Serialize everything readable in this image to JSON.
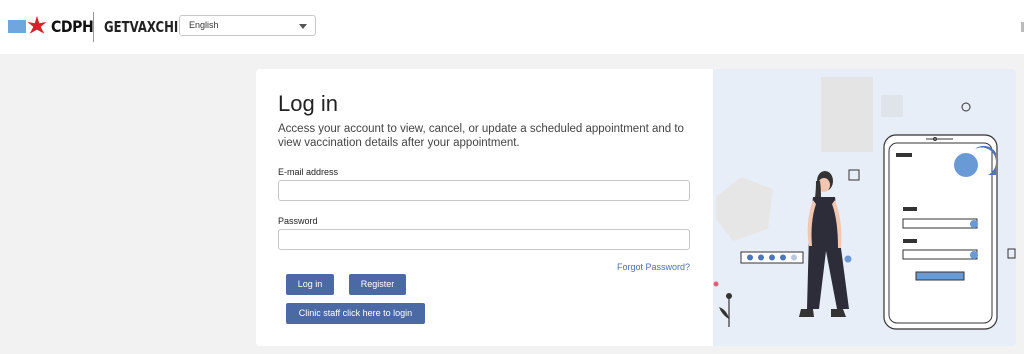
{
  "header": {
    "brand": "CDPH",
    "site_name": "GETVAXCHI",
    "language_value": "English"
  },
  "login": {
    "title": "Log in",
    "subtitle": "Access your account to view, cancel, or update a scheduled appointment and to view vaccination details after your appointment.",
    "email_label": "E-mail address",
    "password_label": "Password",
    "forgot_password": "Forgot Password?",
    "login_button": "Log in",
    "register_button": "Register",
    "clinic_staff_button": "Clinic staff click here to login"
  },
  "colors": {
    "accent": "#4b6aa5",
    "flag_blue": "#6ea6dd",
    "star_red": "#d6202a",
    "illustration_bg": "#e8eef8"
  }
}
